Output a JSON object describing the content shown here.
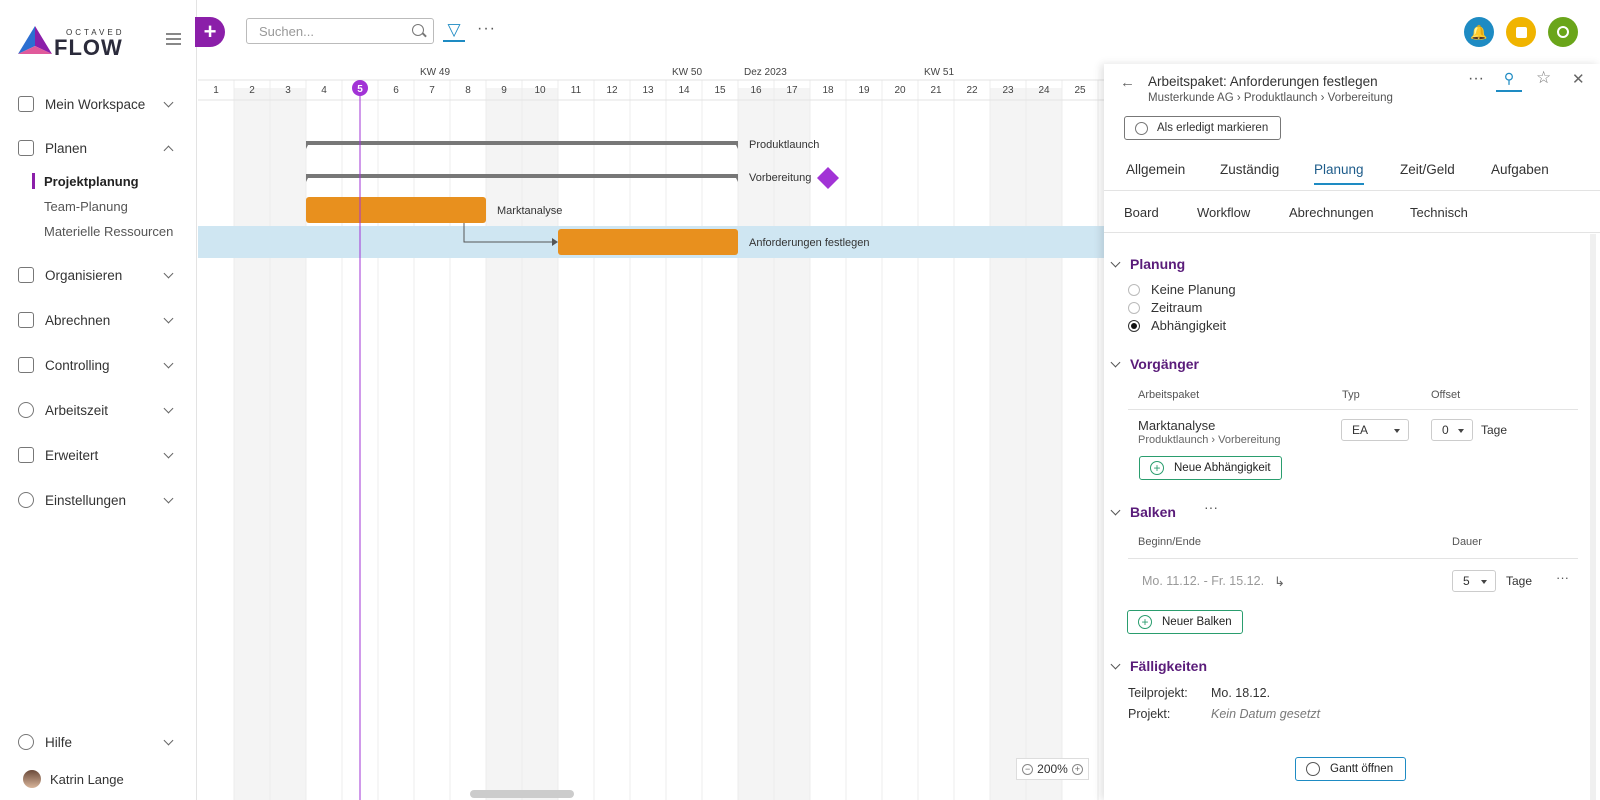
{
  "brand": {
    "top": "OCTAVED",
    "name": "FLOW"
  },
  "sidebar": {
    "items": [
      {
        "label": "Mein Workspace",
        "icon": "inbox-icon"
      },
      {
        "label": "Planen",
        "icon": "calendar-icon"
      },
      {
        "label": "Organisieren",
        "icon": "layers-icon"
      },
      {
        "label": "Abrechnen",
        "icon": "wallet-icon"
      },
      {
        "label": "Controlling",
        "icon": "bar-chart-icon"
      },
      {
        "label": "Arbeitszeit",
        "icon": "clock-icon"
      },
      {
        "label": "Erweitert",
        "icon": "list-icon"
      },
      {
        "label": "Einstellungen",
        "icon": "gear-icon"
      }
    ],
    "planen_sub": [
      "Projektplanung",
      "Team-Planung",
      "Materielle Ressourcen"
    ],
    "help": "Hilfe",
    "user": "Katrin Lange"
  },
  "topbar": {
    "add": "+",
    "search_placeholder": "Suchen...",
    "more": "···",
    "colors": {
      "notifications": "#1e8bc3",
      "notes": "#f0b400",
      "timer": "#6aa51a"
    }
  },
  "gantt": {
    "weeks": [
      {
        "label": "KW 49",
        "day": 7
      },
      {
        "label": "KW 50",
        "day": 14
      },
      {
        "label": "Dez 2023",
        "day": 16
      },
      {
        "label": "KW 51",
        "day": 21
      }
    ],
    "days": [
      1,
      2,
      3,
      4,
      5,
      6,
      7,
      8,
      9,
      10,
      11,
      12,
      13,
      14,
      15,
      16,
      17,
      18,
      19,
      20,
      21,
      22,
      23,
      24,
      25
    ],
    "today": 5,
    "weekend_days": [
      2,
      3,
      9,
      10,
      16,
      17,
      23,
      24
    ],
    "rows": [
      {
        "label": "Produktlaunch",
        "kind": "summary",
        "start": 4,
        "end": 15
      },
      {
        "label": "Vorbereitung",
        "kind": "summary",
        "start": 4,
        "end": 15,
        "milestone": 18
      },
      {
        "label": "Marktanalyse",
        "kind": "task",
        "start": 4,
        "end": 8
      },
      {
        "label": "Anforderungen festlegen",
        "kind": "task",
        "start": 11,
        "end": 15,
        "selected": true
      }
    ],
    "colors": {
      "task": "#e8901e",
      "summary": "#777777",
      "today": "#a233d6",
      "milestone": "#a233d6",
      "selected_row": "#cfe6f2"
    },
    "zoom": "200%"
  },
  "panel": {
    "title": "Arbeitspaket: Anforderungen festlegen",
    "breadcrumb": [
      "Musterkunde AG",
      "Produktlaunch",
      "Vorbereitung"
    ],
    "done_button": "Als erledigt markieren",
    "tabs": [
      "Allgemein",
      "Zuständig",
      "Planung",
      "Zeit/Geld",
      "Aufgaben"
    ],
    "tabs2": [
      "Board",
      "Workflow",
      "Abrechnungen",
      "Technisch"
    ],
    "planung": {
      "heading": "Planung",
      "options": [
        "Keine Planung",
        "Zeitraum",
        "Abhängigkeit"
      ],
      "selected": 2
    },
    "vorgaenger": {
      "heading": "Vorgänger",
      "headers": [
        "Arbeitspaket",
        "Typ",
        "Offset"
      ],
      "row": {
        "name": "Marktanalyse",
        "path": [
          "Produktlaunch",
          "Vorbereitung"
        ],
        "typ": "EA",
        "offset": "0",
        "unit": "Tage"
      },
      "add_button": "Neue Abhängigkeit"
    },
    "balken": {
      "heading": "Balken",
      "more": "···",
      "headers": [
        "Beginn/Ende",
        "Dauer"
      ],
      "row": {
        "range": "Mo. 11.12. - Fr. 15.12.",
        "dauer": "5",
        "unit": "Tage"
      },
      "add_button": "Neuer Balken"
    },
    "faelligkeiten": {
      "heading": "Fälligkeiten",
      "teilprojekt_label": "Teilprojekt:",
      "teilprojekt_value": "Mo. 18.12.",
      "projekt_label": "Projekt:",
      "projekt_value": "Kein Datum gesetzt"
    },
    "gantt_button": "Gantt öffnen"
  }
}
